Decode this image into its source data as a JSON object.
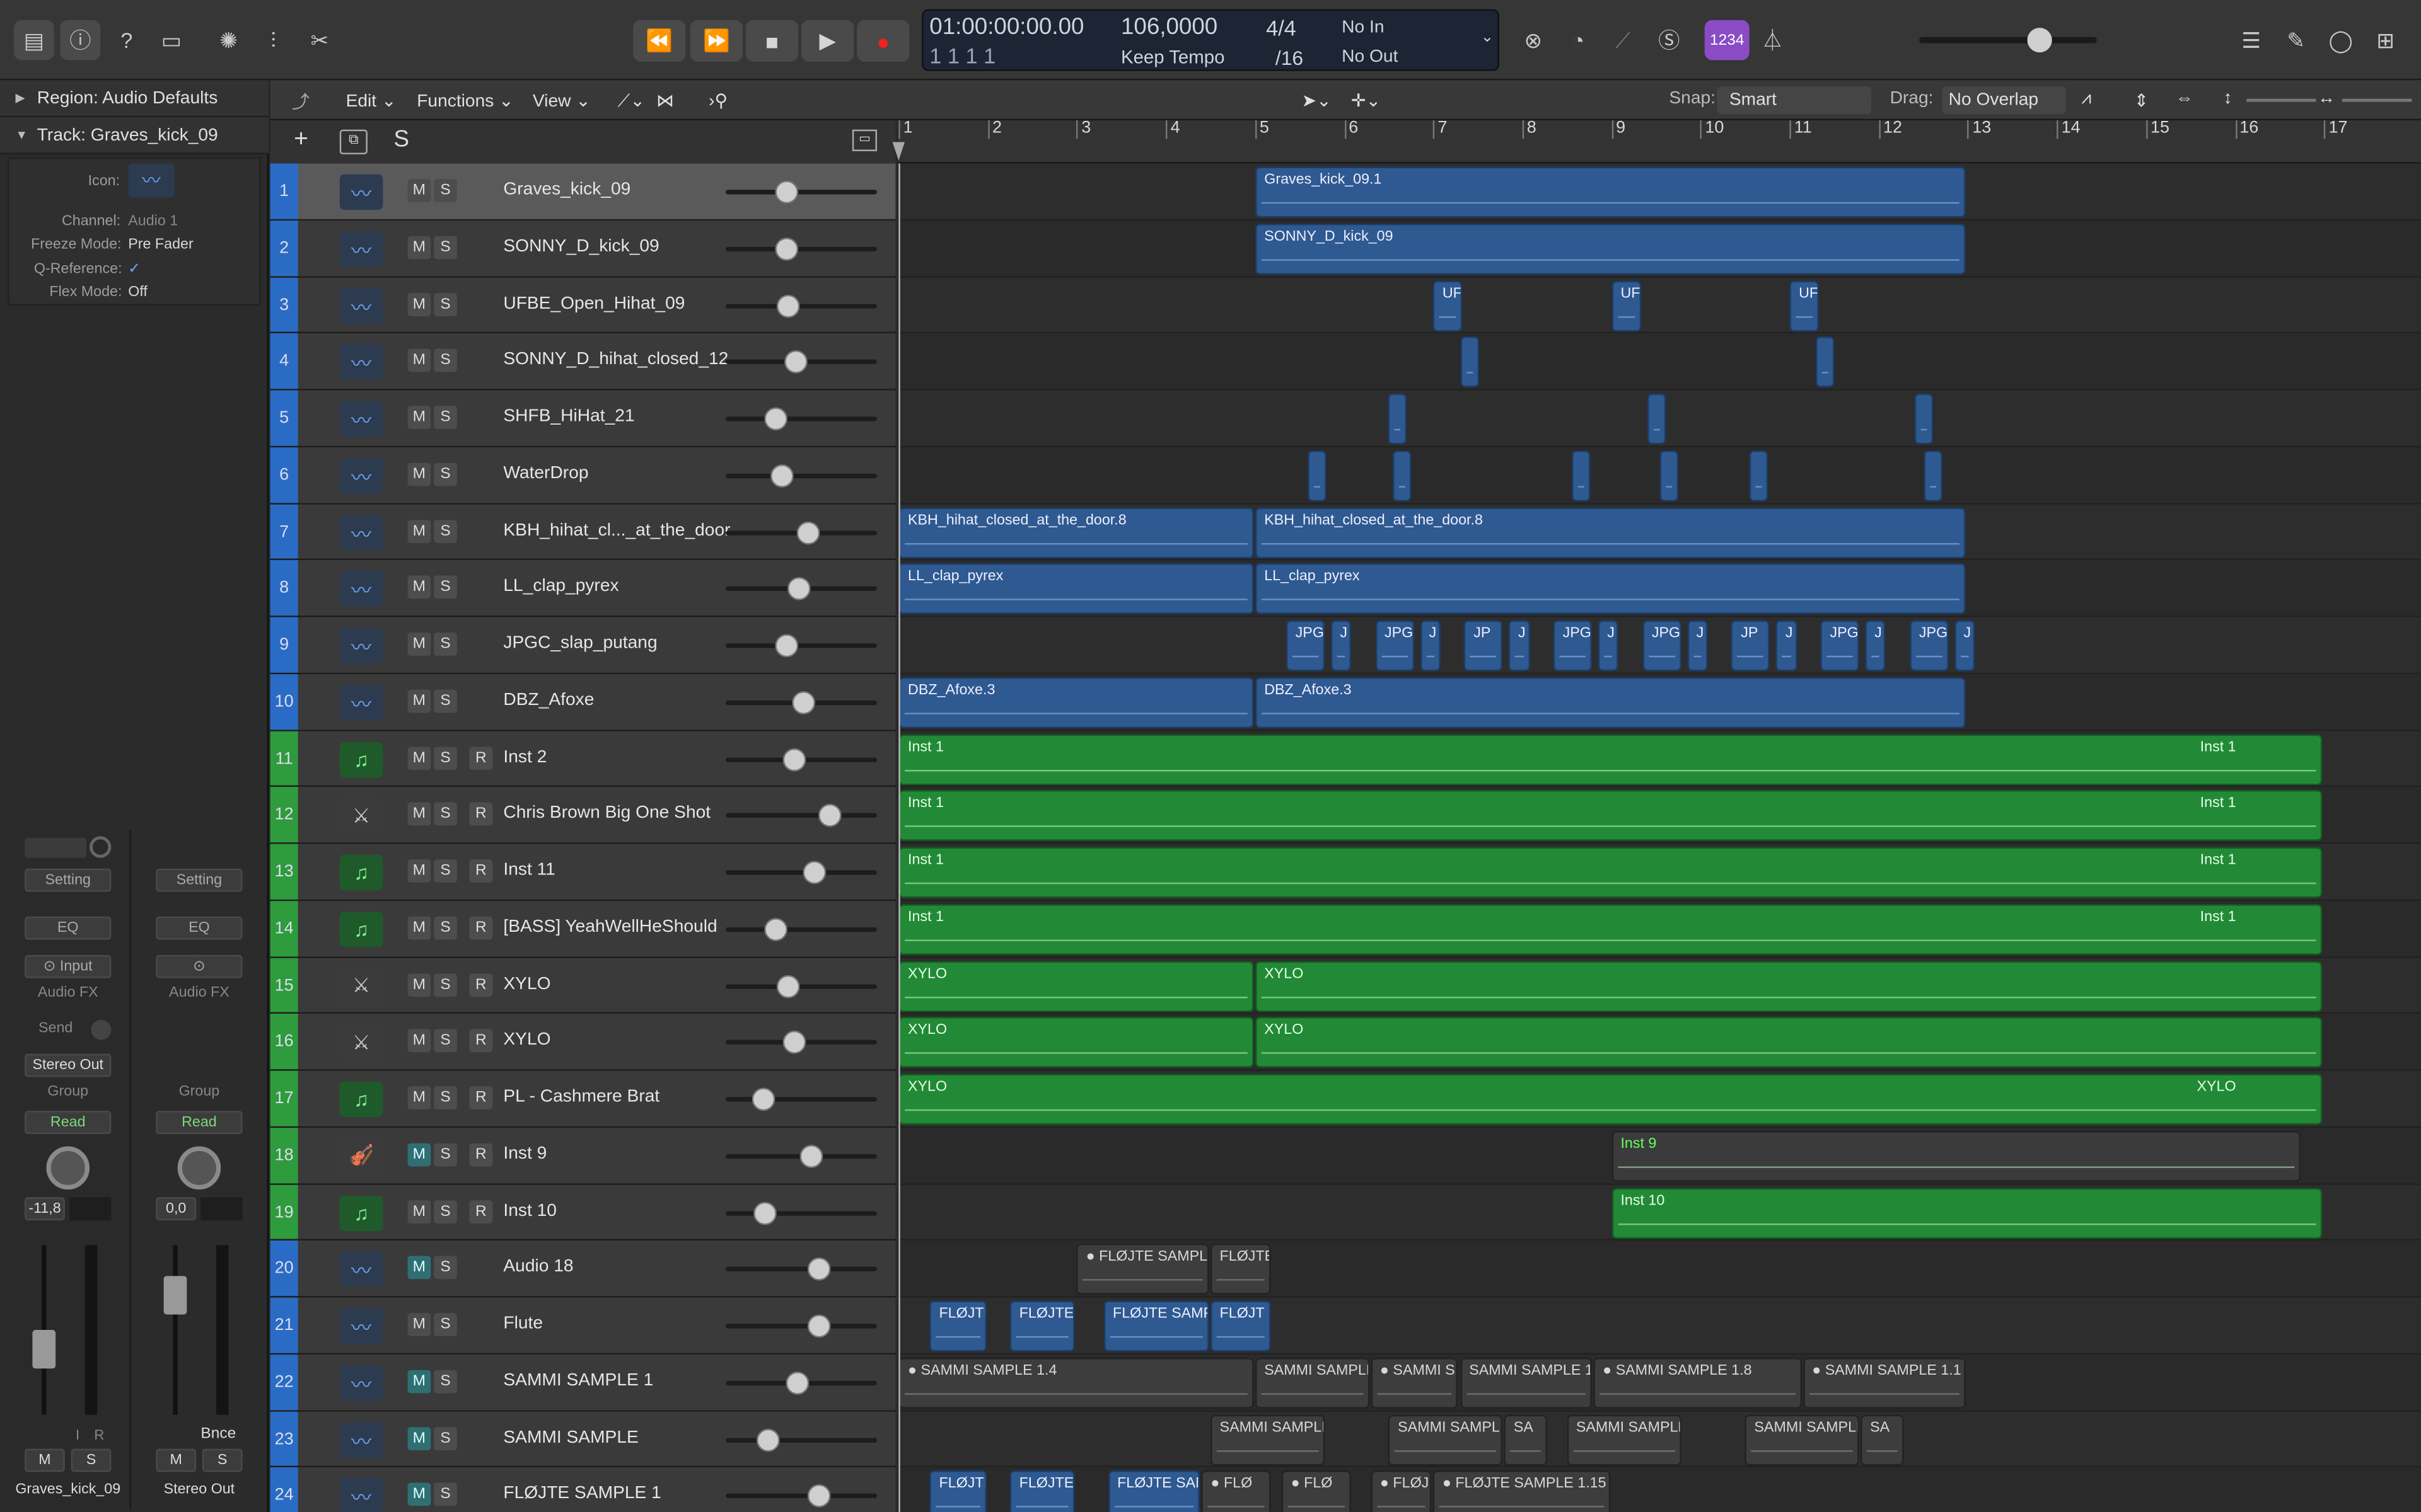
{
  "toolbar": {
    "left_icons": [
      "library-icon",
      "info-icon",
      "help-icon",
      "editor-icon"
    ],
    "mid_icons": [
      "smart-controls-icon",
      "mixer-icon",
      "scissors-icon"
    ],
    "transport": {
      "rewind": "⏪",
      "forward": "⏩",
      "stop": "■",
      "play": "▶",
      "record": "●"
    },
    "lcd": {
      "time": "01:00:00:00.00",
      "bars_row": "1   1   1   1",
      "tempo": "106,0000",
      "tempo_mode": "Keep Tempo",
      "signature": "4/4",
      "division": "/16",
      "in": "No In",
      "out": "No Out"
    },
    "right_icons": [
      "count-in-icon",
      "cpu-icon",
      "tuner-icon",
      "solo-s-icon"
    ],
    "cc_badge": "1234",
    "metronome": "metronome-icon",
    "master_volume": 0.6
  },
  "inspector": {
    "region_label": "Region: Audio Defaults",
    "track_label": "Track: Graves_kick_09",
    "props": [
      {
        "k": "Icon:",
        "v": ""
      },
      {
        "k": "Channel:",
        "v": "Audio 1"
      },
      {
        "k": "Freeze Mode:",
        "v": "Pre Fader"
      },
      {
        "k": "Q-Reference:",
        "v": "✓"
      },
      {
        "k": "Flex Mode:",
        "v": "Off"
      }
    ],
    "strip1": {
      "setting": "Setting",
      "eq": "EQ",
      "input": "Input",
      "fx": "Audio FX",
      "send": "Send",
      "out": "Stereo Out",
      "group": "Group",
      "auto": "Read",
      "db": "-11,8",
      "m": "M",
      "s": "S",
      "i": "I",
      "r": "R",
      "name": "Graves_kick_09"
    },
    "strip2": {
      "setting": "Setting",
      "eq": "EQ",
      "fx": "Audio FX",
      "group": "Group",
      "auto": "Read",
      "db": "0,0",
      "bnce": "Bnce",
      "m": "M",
      "s": "S",
      "name": "Stereo Out"
    }
  },
  "local_bar": {
    "edit": "Edit",
    "functions": "Functions",
    "view": "View",
    "snap_label": "Snap:",
    "snap": "Smart",
    "drag_label": "Drag:",
    "drag": "No Overlap",
    "add": "+",
    "s": "S"
  },
  "ruler": [
    "1",
    "2",
    "3",
    "4",
    "5",
    "6",
    "7",
    "8",
    "9",
    "10",
    "11",
    "12",
    "13",
    "14",
    "15",
    "16",
    "17"
  ],
  "tracks": [
    {
      "n": "1",
      "name": "Graves_kick_09",
      "type": "audio",
      "m": false,
      "r": false,
      "vol": 0.38
    },
    {
      "n": "2",
      "name": "SONNY_D_kick_09",
      "type": "audio",
      "m": false,
      "r": false,
      "vol": 0.38
    },
    {
      "n": "3",
      "name": "UFBE_Open_Hihat_09",
      "type": "audio",
      "m": false,
      "r": false,
      "vol": 0.4
    },
    {
      "n": "4",
      "name": "SONNY_D_hihat_closed_12",
      "type": "audio",
      "m": false,
      "r": false,
      "vol": 0.46
    },
    {
      "n": "5",
      "name": "SHFB_HiHat_21",
      "type": "audio",
      "m": false,
      "r": false,
      "vol": 0.3
    },
    {
      "n": "6",
      "name": "WaterDrop",
      "type": "audio",
      "m": false,
      "r": false,
      "vol": 0.35
    },
    {
      "n": "7",
      "name": "KBH_hihat_cl..._at_the_door",
      "type": "audio",
      "m": false,
      "r": false,
      "vol": 0.55
    },
    {
      "n": "8",
      "name": "LL_clap_pyrex",
      "type": "audio",
      "m": false,
      "r": false,
      "vol": 0.48
    },
    {
      "n": "9",
      "name": "JPGC_slap_putang",
      "type": "audio",
      "m": false,
      "r": false,
      "vol": 0.38
    },
    {
      "n": "10",
      "name": "DBZ_Afoxe",
      "type": "audio",
      "m": false,
      "r": false,
      "vol": 0.52
    },
    {
      "n": "11",
      "name": "Inst 2",
      "type": "inst",
      "m": false,
      "r": true,
      "vol": 0.44
    },
    {
      "n": "12",
      "name": "Chris Brown Big One Shot",
      "type": "drum",
      "m": false,
      "r": true,
      "vol": 0.72
    },
    {
      "n": "13",
      "name": "Inst 11",
      "type": "inst",
      "m": false,
      "r": true,
      "vol": 0.6
    },
    {
      "n": "14",
      "name": "[BASS] YeahWellHeShould",
      "type": "inst",
      "m": false,
      "r": true,
      "vol": 0.3
    },
    {
      "n": "15",
      "name": "XYLO",
      "type": "drum",
      "m": false,
      "r": true,
      "vol": 0.4
    },
    {
      "n": "16",
      "name": "XYLO",
      "type": "drum",
      "m": false,
      "r": true,
      "vol": 0.44
    },
    {
      "n": "17",
      "name": "PL - Cashmere Brat",
      "type": "inst",
      "m": false,
      "r": true,
      "vol": 0.2
    },
    {
      "n": "18",
      "name": "Inst 9",
      "type": "violin",
      "m": true,
      "r": true,
      "vol": 0.58
    },
    {
      "n": "19",
      "name": "Inst 10",
      "type": "inst",
      "m": false,
      "r": true,
      "vol": 0.22
    },
    {
      "n": "20",
      "name": "Audio 18",
      "type": "audio",
      "m": true,
      "r": false,
      "vol": 0.64
    },
    {
      "n": "21",
      "name": "Flute",
      "type": "audio",
      "m": false,
      "r": false,
      "vol": 0.64
    },
    {
      "n": "22",
      "name": "SAMMI SAMPLE 1",
      "type": "audio",
      "m": true,
      "r": false,
      "vol": 0.47
    },
    {
      "n": "23",
      "name": "SAMMI SAMPLE",
      "type": "audio",
      "m": true,
      "r": false,
      "vol": 0.24
    },
    {
      "n": "24",
      "name": "FLØJTE SAMPLE 1",
      "type": "audio",
      "m": true,
      "r": false,
      "vol": 0.64
    }
  ],
  "regions": [
    [
      {
        "s": 5,
        "e": 13,
        "t": "Graves_kick_09.1",
        "c": "a"
      }
    ],
    [
      {
        "s": 5,
        "e": 13,
        "t": "SONNY_D_kick_09",
        "c": "a"
      }
    ],
    [
      {
        "s": 7,
        "e": 7.35,
        "t": "UF",
        "c": "a"
      },
      {
        "s": 9,
        "e": 9.35,
        "t": "UF",
        "c": "a"
      },
      {
        "s": 11,
        "e": 11.35,
        "t": "UF",
        "c": "a"
      }
    ],
    [
      {
        "s": 7.3,
        "e": 7.45,
        "t": "",
        "c": "a"
      },
      {
        "s": 11.3,
        "e": 11.45,
        "t": "",
        "c": "a"
      }
    ],
    [
      {
        "s": 6.5,
        "e": 6.65,
        "t": "",
        "c": "a"
      },
      {
        "s": 9.4,
        "e": 9.55,
        "t": "",
        "c": "a"
      },
      {
        "s": 12.4,
        "e": 12.55,
        "t": "",
        "c": "a"
      }
    ],
    [
      {
        "s": 5.6,
        "e": 5.7,
        "t": "",
        "c": "a"
      },
      {
        "s": 6.55,
        "e": 6.65,
        "t": "",
        "c": "a"
      },
      {
        "s": 8.55,
        "e": 8.65,
        "t": "",
        "c": "a"
      },
      {
        "s": 9.55,
        "e": 9.65,
        "t": "",
        "c": "a"
      },
      {
        "s": 10.55,
        "e": 10.65,
        "t": "",
        "c": "a"
      },
      {
        "s": 12.5,
        "e": 12.6,
        "t": "",
        "c": "a"
      }
    ],
    [
      {
        "s": 1,
        "e": 5,
        "t": "KBH_hihat_closed_at_the_door.8",
        "c": "a"
      },
      {
        "s": 5,
        "e": 13,
        "t": "KBH_hihat_closed_at_the_door.8",
        "c": "a"
      }
    ],
    [
      {
        "s": 1,
        "e": 5,
        "t": "LL_clap_pyrex",
        "c": "a"
      },
      {
        "s": 5,
        "e": 13,
        "t": "LL_clap_pyrex",
        "c": "a"
      }
    ],
    [
      {
        "s": 5.35,
        "e": 5.8,
        "t": "JPG",
        "c": "a"
      },
      {
        "s": 5.85,
        "e": 6.1,
        "t": "J",
        "c": "a"
      },
      {
        "s": 6.35,
        "e": 6.8,
        "t": "JPG",
        "c": "a"
      },
      {
        "s": 6.85,
        "e": 7.1,
        "t": "J",
        "c": "a"
      },
      {
        "s": 7.35,
        "e": 7.8,
        "t": "JP",
        "c": "a"
      },
      {
        "s": 7.85,
        "e": 8.1,
        "t": "J",
        "c": "a"
      },
      {
        "s": 8.35,
        "e": 8.8,
        "t": "JPG",
        "c": "a"
      },
      {
        "s": 8.85,
        "e": 9.1,
        "t": "J",
        "c": "a"
      },
      {
        "s": 9.35,
        "e": 9.8,
        "t": "JPG",
        "c": "a"
      },
      {
        "s": 9.85,
        "e": 10.1,
        "t": "J",
        "c": "a"
      },
      {
        "s": 10.35,
        "e": 10.8,
        "t": "JP",
        "c": "a"
      },
      {
        "s": 10.85,
        "e": 11.1,
        "t": "J",
        "c": "a"
      },
      {
        "s": 11.35,
        "e": 11.8,
        "t": "JPG",
        "c": "a"
      },
      {
        "s": 11.85,
        "e": 12.1,
        "t": "J",
        "c": "a"
      },
      {
        "s": 12.35,
        "e": 12.8,
        "t": "JPG",
        "c": "a"
      },
      {
        "s": 12.85,
        "e": 13.1,
        "t": "J",
        "c": "a"
      }
    ],
    [
      {
        "s": 1,
        "e": 5,
        "t": "DBZ_Afoxe.3",
        "c": "a"
      },
      {
        "s": 5,
        "e": 13,
        "t": "DBZ_Afoxe.3",
        "c": "a"
      }
    ],
    [
      {
        "s": 1,
        "e": 17,
        "t": "Inst 1",
        "t2": "Inst 1",
        "c": "m"
      }
    ],
    [
      {
        "s": 1,
        "e": 17,
        "t": "Inst 1",
        "t2": "Inst 1",
        "c": "m"
      }
    ],
    [
      {
        "s": 1,
        "e": 17,
        "t": "Inst 1",
        "t2": "Inst 1",
        "c": "m"
      }
    ],
    [
      {
        "s": 1,
        "e": 17,
        "t": "Inst 1",
        "t2": "Inst 1",
        "c": "m"
      }
    ],
    [
      {
        "s": 1,
        "e": 5,
        "t": "XYLO",
        "c": "m"
      },
      {
        "s": 5,
        "e": 17,
        "t": "XYLO",
        "c": "m"
      }
    ],
    [
      {
        "s": 1,
        "e": 5,
        "t": "XYLO",
        "c": "m"
      },
      {
        "s": 5,
        "e": 17,
        "t": "XYLO",
        "c": "m"
      }
    ],
    [
      {
        "s": 1,
        "e": 17,
        "t": "XYLO",
        "t2": "XYLO",
        "c": "m"
      }
    ],
    [
      {
        "s": 9,
        "e": 16.75,
        "t": "Inst 9",
        "c": "m9"
      }
    ],
    [
      {
        "s": 9,
        "e": 17,
        "t": "Inst 10",
        "c": "m"
      }
    ],
    [
      {
        "s": 3,
        "e": 4.5,
        "t": "● FLØJTE SAMPL",
        "c": "g"
      },
      {
        "s": 4.5,
        "e": 5.2,
        "t": "FLØJTE",
        "c": "g"
      }
    ],
    [
      {
        "s": 1.35,
        "e": 2,
        "t": "FLØJTE",
        "c": "a"
      },
      {
        "s": 2.25,
        "e": 3,
        "t": "FLØJTE",
        "c": "a"
      },
      {
        "s": 3.3,
        "e": 4.5,
        "t": "FLØJTE SAMP",
        "c": "a"
      },
      {
        "s": 4.5,
        "e": 5.2,
        "t": "FLØJT",
        "c": "a"
      }
    ],
    [
      {
        "s": 1,
        "e": 5,
        "t": "● SAMMI SAMPLE 1.4",
        "c": "g"
      },
      {
        "s": 5,
        "e": 6.3,
        "t": "SAMMI SAMPLE",
        "c": "g"
      },
      {
        "s": 6.3,
        "e": 7.3,
        "t": "● SAMMI S",
        "c": "g"
      },
      {
        "s": 7.3,
        "e": 8.8,
        "t": "SAMMI SAMPLE 1.15",
        "c": "g"
      },
      {
        "s": 8.8,
        "e": 11.15,
        "t": "● SAMMI SAMPLE 1.8",
        "c": "g"
      },
      {
        "s": 11.15,
        "e": 13,
        "t": "● SAMMI SAMPLE 1.1",
        "c": "g"
      }
    ],
    [
      {
        "s": 4.5,
        "e": 5.8,
        "t": "SAMMI SAMPLE",
        "c": "g"
      },
      {
        "s": 6.5,
        "e": 7.8,
        "t": "SAMMI SAMPLE",
        "c": "g"
      },
      {
        "s": 7.8,
        "e": 8.3,
        "t": "SA",
        "c": "g"
      },
      {
        "s": 8.5,
        "e": 9.8,
        "t": "SAMMI SAMPLE",
        "c": "g"
      },
      {
        "s": 10.5,
        "e": 11.8,
        "t": "SAMMI SAMPLE",
        "c": "g"
      },
      {
        "s": 11.8,
        "e": 12.3,
        "t": "SA",
        "c": "g"
      }
    ],
    [
      {
        "s": 1.35,
        "e": 2,
        "t": "FLØJTE",
        "c": "a"
      },
      {
        "s": 2.25,
        "e": 3,
        "t": "FLØJTE",
        "c": "a"
      },
      {
        "s": 3.35,
        "e": 4.4,
        "t": "FLØJTE SAMP",
        "c": "a"
      },
      {
        "s": 4.4,
        "e": 5.2,
        "t": "● FLØ",
        "c": "g"
      },
      {
        "s": 5.3,
        "e": 6.1,
        "t": "● FLØ",
        "c": "g"
      },
      {
        "s": 6.3,
        "e": 7,
        "t": "● FLØJ",
        "c": "g"
      },
      {
        "s": 7,
        "e": 9,
        "t": "● FLØJTE SAMPLE 1.15",
        "c": "g"
      }
    ]
  ]
}
